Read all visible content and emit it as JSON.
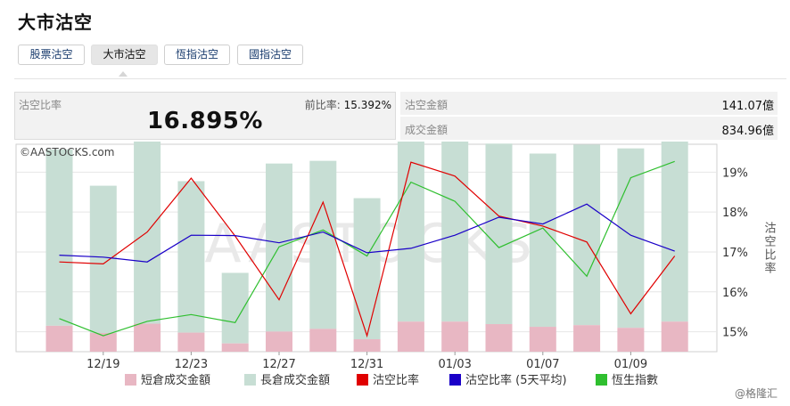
{
  "page": {
    "title": "大市沽空"
  },
  "tabs": [
    {
      "label": "股票沽空",
      "active": false
    },
    {
      "label": "大市沽空",
      "active": true
    },
    {
      "label": "恆指沽空",
      "active": false
    },
    {
      "label": "國指沽空",
      "active": false
    }
  ],
  "summary": {
    "ratio_label": "沽空比率",
    "ratio_value": "16.895%",
    "prev_label": "前比率:",
    "prev_value": "15.392%",
    "short_amount_label": "沽空金額",
    "short_amount_value": "141.07億",
    "turnover_label": "成交金額",
    "turnover_value": "834.96億"
  },
  "chart_watermark": "©AASTOCKS.com",
  "chart_background_text": "AASTOCKS",
  "credit": "@格隆汇",
  "colors": {
    "short_turnover_bar": "#e8b7c3",
    "long_turnover_bar": "#c7ded4",
    "ratio_line": "#e00000",
    "ratio_avg_line": "#1a00c8",
    "hsi_line": "#2fbf2f",
    "active_tab_bg": "#e6e6e6",
    "stat_bg": "#f2f2f2"
  },
  "chart_data": {
    "type": "bar",
    "x_ticks": [
      "12/19",
      "12/23",
      "12/27",
      "12/31",
      "01/03",
      "01/07",
      "01/09"
    ],
    "y_right_label": "沽空比率",
    "y_right_ticks": [
      "15%",
      "16%",
      "17%",
      "18%",
      "19%"
    ],
    "y_right_range": [
      14.5,
      19.7
    ],
    "total_bar_range": [
      0,
      1000
    ],
    "grid": true,
    "legend_position": "bottom",
    "legend": [
      "短倉成交金額",
      "長倉成交金額",
      "沽空比率",
      "沽空比率 (5天平均)",
      "恆生指數"
    ],
    "series": [
      {
        "name": "短倉成交金額",
        "kind": "bar",
        "values": [
          125,
          90,
          135,
          92,
          40,
          97,
          110,
          60,
          145,
          145,
          133,
          120,
          128,
          115,
          145
        ]
      },
      {
        "name": "長倉成交金額",
        "kind": "bar",
        "values": [
          850,
          710,
          895,
          730,
          340,
          810,
          810,
          680,
          875,
          890,
          870,
          835,
          870,
          865,
          905
        ]
      },
      {
        "name": "沽空比率",
        "kind": "line",
        "values": [
          16.75,
          16.7,
          17.5,
          18.85,
          17.4,
          15.8,
          18.25,
          14.9,
          19.25,
          18.9,
          17.9,
          17.65,
          17.25,
          15.45,
          16.9
        ]
      },
      {
        "name": "沽空比率 (5天平均)",
        "kind": "line",
        "values": [
          16.92,
          16.87,
          16.75,
          17.42,
          17.41,
          17.23,
          17.5,
          16.98,
          17.09,
          17.42,
          17.87,
          17.7,
          18.2,
          17.42,
          17.02
        ]
      },
      {
        "name": "恆生指數",
        "kind": "line",
        "values": [
          15.33,
          14.9,
          15.26,
          15.43,
          15.23,
          17.13,
          17.55,
          16.9,
          18.75,
          18.27,
          17.11,
          17.6,
          16.39,
          18.86,
          19.27
        ]
      }
    ]
  }
}
